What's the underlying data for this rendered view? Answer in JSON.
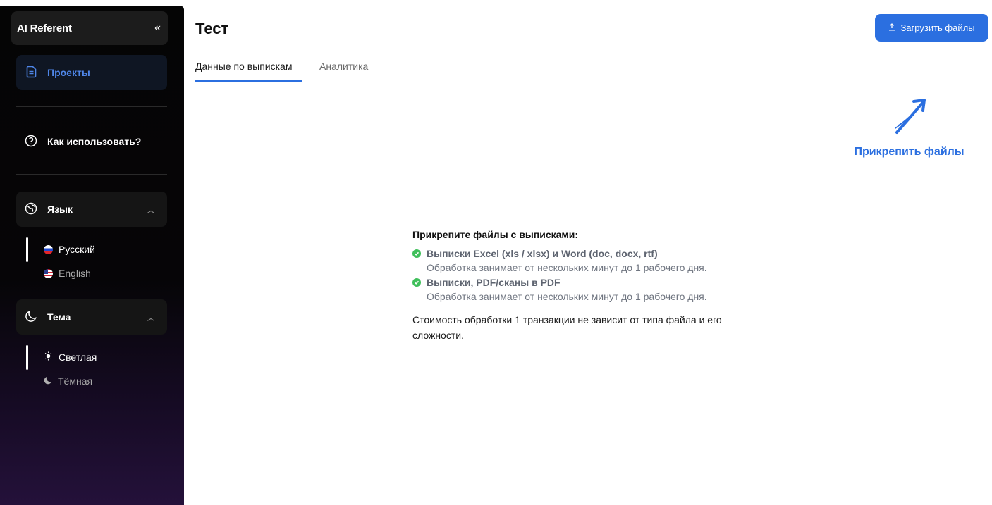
{
  "sidebar": {
    "title": "AI Referent",
    "collapse_glyph": "«",
    "projects_label": "Проекты",
    "howto_label": "Как использовать?",
    "language": {
      "label": "Язык",
      "options": [
        {
          "label": "Русский",
          "flag": "flag-ru-icon",
          "active": true
        },
        {
          "label": "English",
          "flag": "flag-us-icon",
          "active": false
        }
      ]
    },
    "theme": {
      "label": "Тема",
      "options": [
        {
          "label": "Светлая",
          "icon": "sun-icon",
          "active": true
        },
        {
          "label": "Тёмная",
          "icon": "moon-icon",
          "active": false
        }
      ]
    }
  },
  "header": {
    "title": "Тест",
    "upload_button": "Загрузить файлы"
  },
  "tabs": [
    {
      "label": "Данные по выпискам",
      "active": true
    },
    {
      "label": "Аналитика",
      "active": false
    }
  ],
  "attach_hint": "Прикрепить файлы",
  "info": {
    "heading": "Прикрепите файлы с выписками:",
    "items": [
      {
        "title": "Выписки Excel (xls / xlsx) и Word (doc, docx, rtf)",
        "desc": "Обработка занимает от нескольких минут до 1 рабочего дня."
      },
      {
        "title": "Выписки, PDF/сканы в PDF",
        "desc": "Обработка занимает от нескольких минут до 1 рабочего дня."
      }
    ],
    "note": "Стоимость обработки 1 транзакции не зависит от типа файла и его сложности."
  },
  "colors": {
    "accent": "#2b6fe0",
    "check": "#3fbf5a",
    "sidebar_bg": "#050505"
  }
}
